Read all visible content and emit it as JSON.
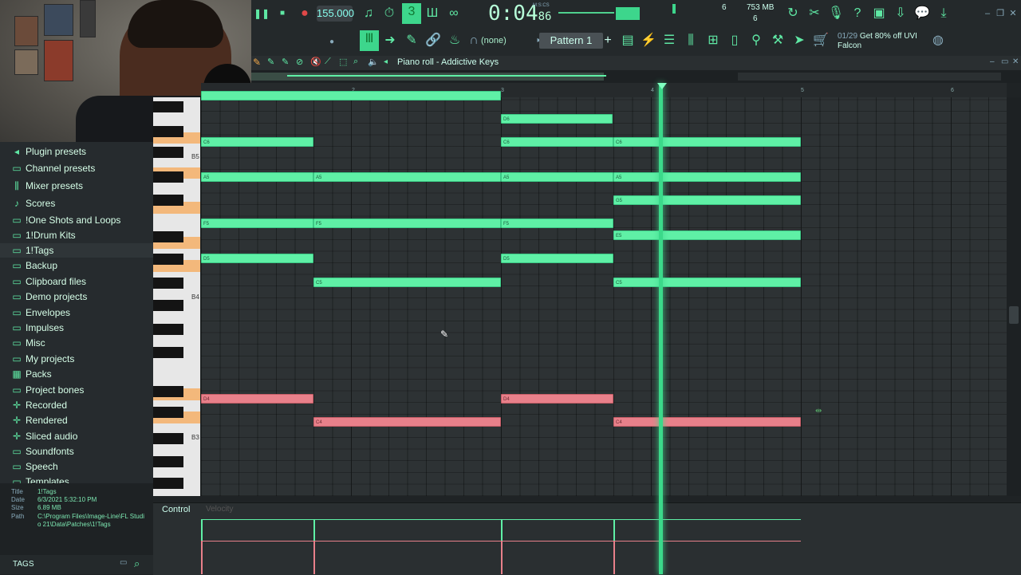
{
  "transport": {
    "tempo": "155.000",
    "time_main": "0:04",
    "time_sub": "86",
    "time_format": "M:S:CS",
    "memory": "753 MB",
    "cpu_top": "6",
    "cpu_bottom": "6"
  },
  "toolbar": {
    "channel_select": "(none)",
    "pattern": "Pattern 1",
    "news_line1_date": "01/29",
    "news_line1": "Get 80% off UVI",
    "news_line2": "Falcon"
  },
  "piano_roll": {
    "title": "Piano roll - Addictive Keys",
    "ruler": [
      "2",
      "3",
      "4",
      "5",
      "6"
    ],
    "octave_labels": [
      "B5",
      "B4",
      "B3"
    ],
    "notes_green": [
      {
        "label": "D6"
      },
      {
        "label": "C6"
      },
      {
        "label": "C6"
      },
      {
        "label": "C6"
      },
      {
        "label": "A5"
      },
      {
        "label": "A5"
      },
      {
        "label": "A5"
      },
      {
        "label": "A5"
      },
      {
        "label": "G5"
      },
      {
        "label": "F5"
      },
      {
        "label": "F5"
      },
      {
        "label": "F5"
      },
      {
        "label": "E5"
      },
      {
        "label": "D5"
      },
      {
        "label": "D5"
      },
      {
        "label": "C5"
      },
      {
        "label": "C5"
      }
    ],
    "notes_red": [
      {
        "label": "D4"
      },
      {
        "label": "D4"
      },
      {
        "label": "C4"
      },
      {
        "label": "C4"
      }
    ],
    "control_label": "Control",
    "control_param": "Velocity"
  },
  "browser": {
    "items": [
      {
        "label": "Plugin presets",
        "icon": "plugin-icon"
      },
      {
        "label": "Channel presets",
        "icon": "folder-icon"
      },
      {
        "label": "Mixer presets",
        "icon": "mixer-icon"
      },
      {
        "label": "Scores",
        "icon": "note-icon"
      },
      {
        "label": "!One Shots and Loops",
        "icon": "folder-icon"
      },
      {
        "label": "1!Drum Kits",
        "icon": "folder-icon"
      },
      {
        "label": "1!Tags",
        "icon": "folder-icon"
      },
      {
        "label": "Backup",
        "icon": "folder-icon"
      },
      {
        "label": "Clipboard files",
        "icon": "folder-icon"
      },
      {
        "label": "Demo projects",
        "icon": "folder-icon"
      },
      {
        "label": "Envelopes",
        "icon": "folder-icon"
      },
      {
        "label": "Impulses",
        "icon": "folder-icon"
      },
      {
        "label": "Misc",
        "icon": "folder-icon"
      },
      {
        "label": "My projects",
        "icon": "folder-icon"
      },
      {
        "label": "Packs",
        "icon": "packs-icon"
      },
      {
        "label": "Project bones",
        "icon": "folder-icon"
      },
      {
        "label": "Recorded",
        "icon": "plus-icon"
      },
      {
        "label": "Rendered",
        "icon": "plus-icon"
      },
      {
        "label": "Sliced audio",
        "icon": "plus-icon"
      },
      {
        "label": "Soundfonts",
        "icon": "folder-icon"
      },
      {
        "label": "Speech",
        "icon": "folder-icon"
      },
      {
        "label": "Templates",
        "icon": "folder-icon"
      }
    ],
    "info": {
      "title_key": "Title",
      "title": "1!Tags",
      "date_key": "Date",
      "date": "6/3/2021 5:32:10 PM",
      "size_key": "Size",
      "size": "6.89 MB",
      "path_key": "Path",
      "path": "C:\\Program Files\\Image-Line\\FL Studio 21\\Data\\Patches\\1!Tags"
    },
    "tags_label": "TAGS"
  },
  "colors": {
    "accent": "#5ff0a6",
    "note_green": "#5ff0a6",
    "note_red": "#e8808a",
    "playhead": "#3bd98a",
    "key_highlight": "#f3b87b"
  }
}
